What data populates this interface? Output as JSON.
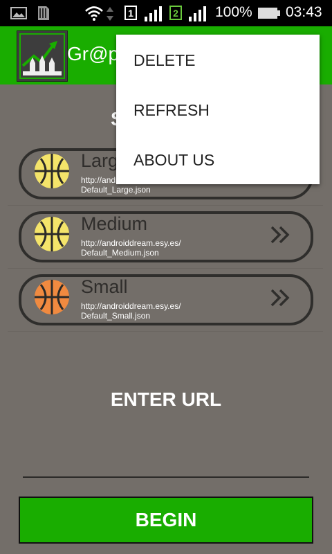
{
  "status_bar": {
    "icons": [
      "gallery-icon",
      "sim-card-icon",
      "wifi-icon",
      "sim1-icon",
      "signal-icon",
      "sim2-icon",
      "signal-icon",
      "battery-icon"
    ],
    "sim1_label": "1",
    "sim2_label": "2",
    "battery": "100%",
    "time": "03:43"
  },
  "app_bar": {
    "title": "Gr@p",
    "logo_icon": "rocket-chart-logo-icon",
    "color": "#19ad00"
  },
  "subheading": "S",
  "list": {
    "items": [
      {
        "name": "Larg",
        "url_line1": "http://andr",
        "url_line2": "Default_Large.json",
        "icon": "globe-yellow-icon",
        "icon_color": "#f4e46a"
      },
      {
        "name": "Medium",
        "url_line1": "http://androiddream.esy.es/",
        "url_line2": "Default_Medium.json",
        "icon": "globe-yellow-icon",
        "icon_color": "#f4e46a"
      },
      {
        "name": "Small",
        "url_line1": "http://androiddream.esy.es/",
        "url_line2": "Default_Small.json",
        "icon": "globe-orange-icon",
        "icon_color": "#f08a40"
      }
    ]
  },
  "enter_url": "ENTER URL",
  "begin_label": "BEGIN",
  "menu": {
    "items": [
      "DELETE",
      "REFRESH",
      "ABOUT US"
    ]
  }
}
